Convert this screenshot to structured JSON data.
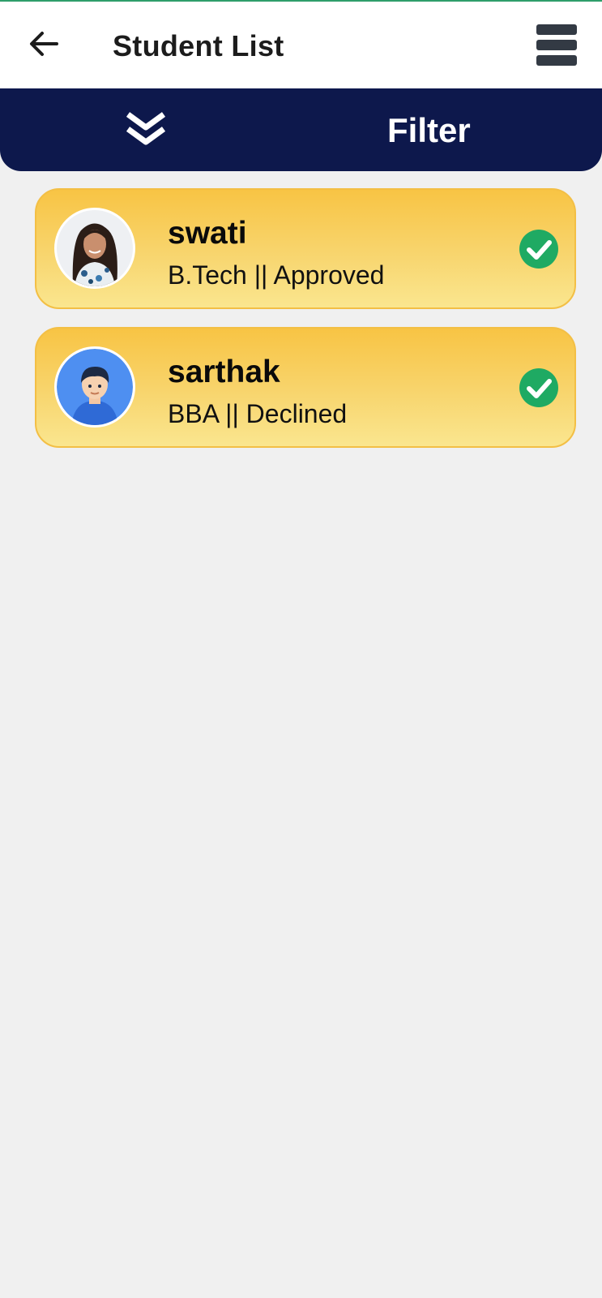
{
  "header": {
    "title": "Student List",
    "back_icon": "arrow-left-icon",
    "menu_icon": "hamburger-menu-icon"
  },
  "filter_bar": {
    "label": "Filter",
    "icon": "double-chevron-down-icon",
    "background": "#0d184c"
  },
  "students": [
    {
      "name": "swati",
      "subtitle": "B.Tech || Approved",
      "avatar": "photo-avatar",
      "status_icon": "check-circle-icon"
    },
    {
      "name": "sarthak",
      "subtitle": "BBA || Declined",
      "avatar": "default-male-avatar",
      "status_icon": "check-circle-icon"
    }
  ],
  "colors": {
    "card_top": "#f8c444",
    "card_bottom": "#fae68f",
    "check_green": "#1faa63"
  }
}
